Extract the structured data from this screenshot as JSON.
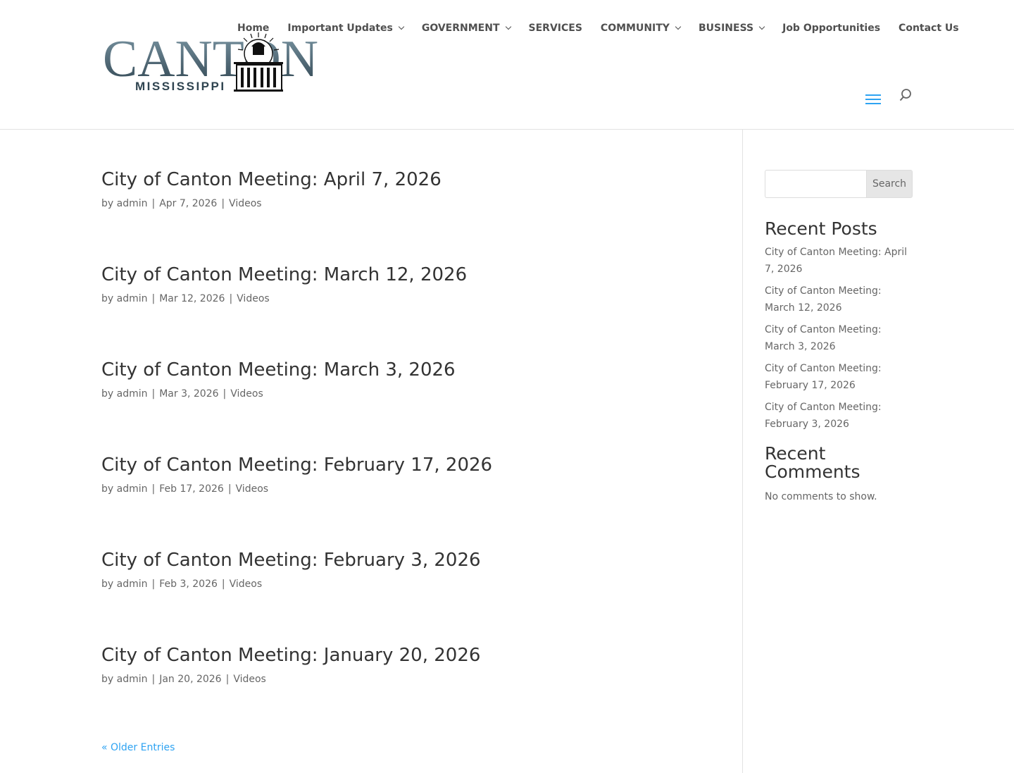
{
  "header": {
    "logo": {
      "name": "CANTON",
      "state": "MISSISSIPPI",
      "colors": {
        "primary": "#2f4450",
        "gradient_end": "#7d98a6",
        "accent": "#111111"
      }
    },
    "nav": [
      {
        "label": "Home",
        "dropdown": false
      },
      {
        "label": "Important Updates",
        "dropdown": true
      },
      {
        "label": "GOVERNMENT",
        "dropdown": true
      },
      {
        "label": "SERVICES",
        "dropdown": false
      },
      {
        "label": "COMMUNITY",
        "dropdown": true
      },
      {
        "label": "BUSINESS",
        "dropdown": true
      },
      {
        "label": "Job Opportunities",
        "dropdown": false
      },
      {
        "label": "Contact Us",
        "dropdown": false
      }
    ],
    "menu_icon": "hamburger-icon",
    "search_icon": "search-icon",
    "accent_color": "#2ea3f2"
  },
  "posts": [
    {
      "title": "City of Canton Meeting: April 7, 2026",
      "author": "admin",
      "date": "Apr 7, 2026",
      "category": "Videos"
    },
    {
      "title": "City of Canton Meeting: March 12, 2026",
      "author": "admin",
      "date": "Mar 12, 2026",
      "category": "Videos"
    },
    {
      "title": "City of Canton Meeting: March 3, 2026",
      "author": "admin",
      "date": "Mar 3, 2026",
      "category": "Videos"
    },
    {
      "title": "City of Canton Meeting: February 17, 2026",
      "author": "admin",
      "date": "Feb 17, 2026",
      "category": "Videos"
    },
    {
      "title": "City of Canton Meeting: February 3, 2026",
      "author": "admin",
      "date": "Feb 3, 2026",
      "category": "Videos"
    },
    {
      "title": "City of Canton Meeting: January 20, 2026",
      "author": "admin",
      "date": "Jan 20, 2026",
      "category": "Videos"
    }
  ],
  "meta": {
    "by": "by",
    "separator": "|"
  },
  "pagination": {
    "older_label": "« Older Entries"
  },
  "sidebar": {
    "search": {
      "value": "",
      "placeholder": "",
      "button_label": "Search"
    },
    "recent_posts": {
      "title": "Recent Posts",
      "items": [
        "City of Canton Meeting: April 7, 2026",
        "City of Canton Meeting: March 12, 2026",
        "City of Canton Meeting: March 3, 2026",
        "City of Canton Meeting: February 17, 2026",
        "City of Canton Meeting: February 3, 2026"
      ]
    },
    "recent_comments": {
      "title": "Recent Comments",
      "empty_text": "No comments to show."
    }
  }
}
